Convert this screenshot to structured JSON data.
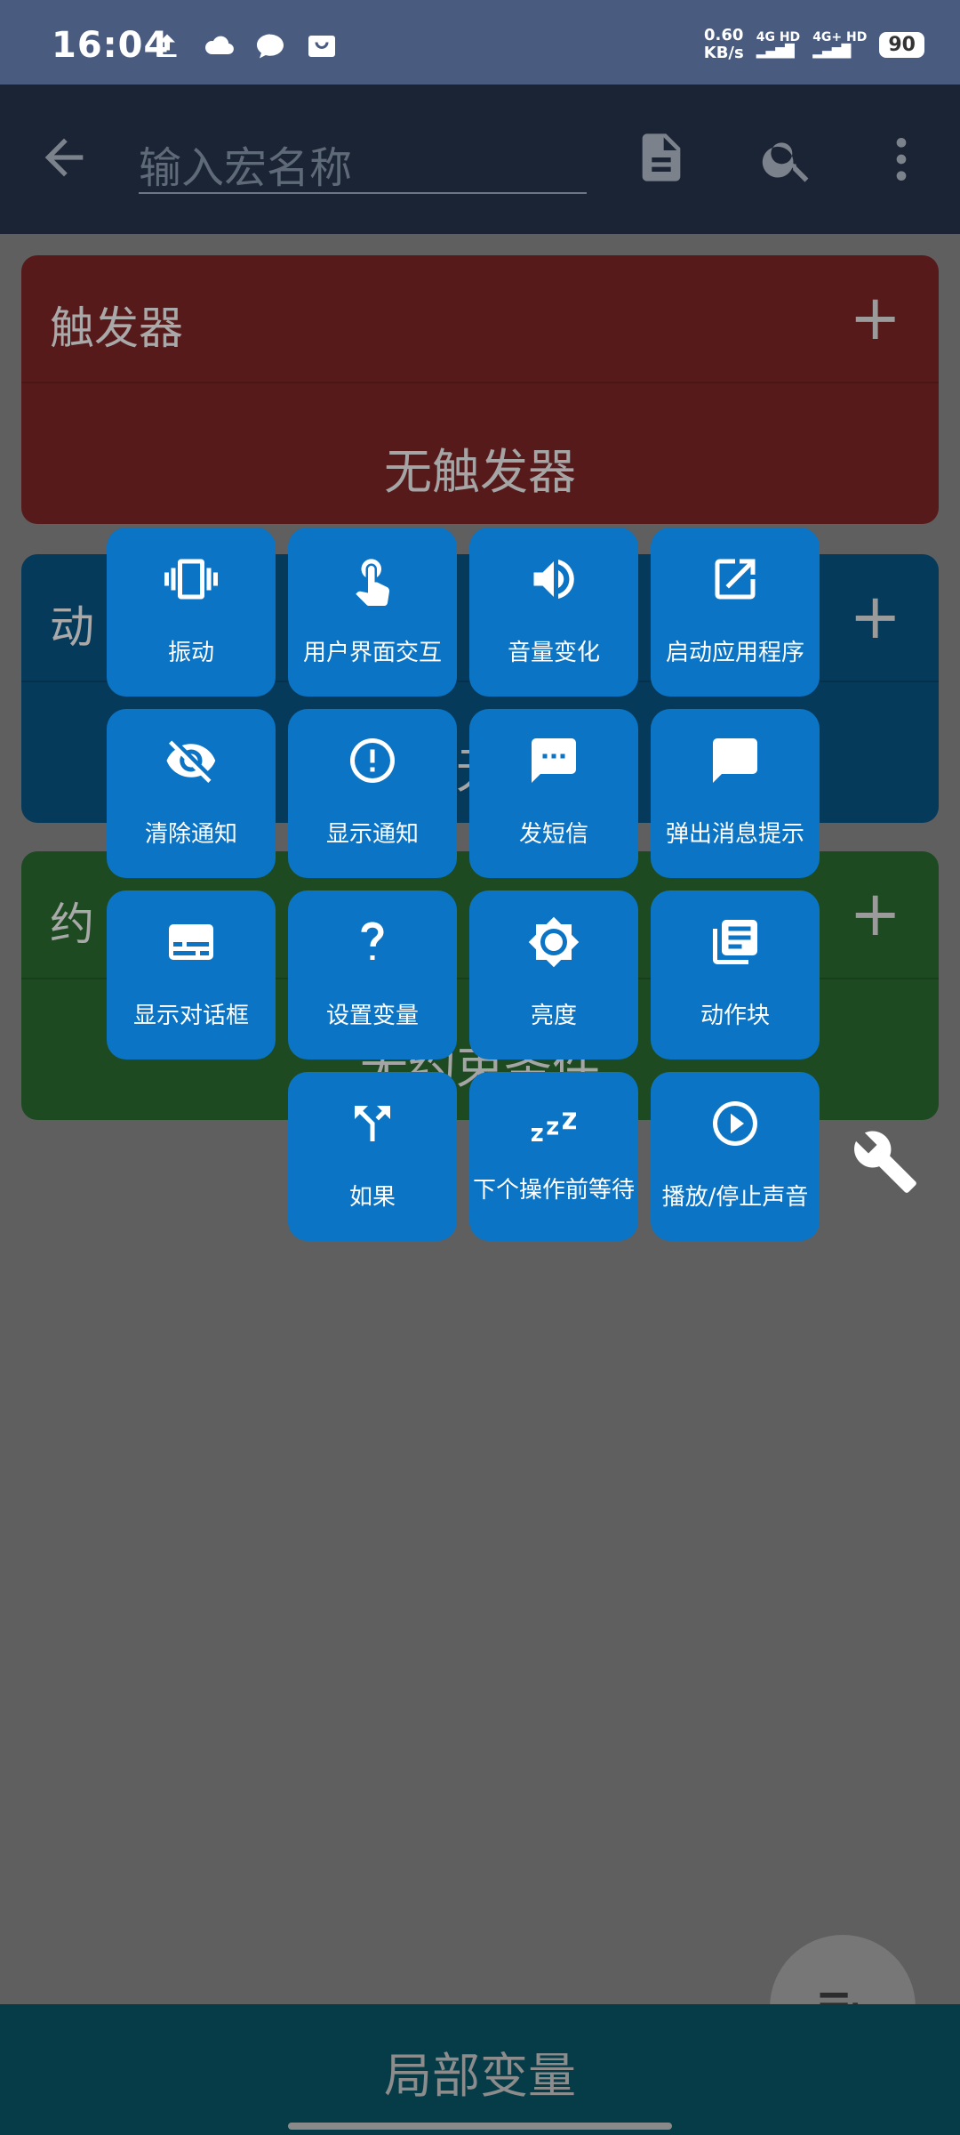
{
  "status_bar": {
    "time": "16:04",
    "speed_value": "0.60",
    "speed_unit": "KB/s",
    "net1": "4G HD",
    "net2": "4G+ HD",
    "battery": "90"
  },
  "app_bar": {
    "name_placeholder": "输入宏名称"
  },
  "cards": {
    "triggers": {
      "title": "触发器",
      "empty": "无触发器",
      "color": "#571a1b"
    },
    "actions": {
      "title_partial": "动",
      "empty_partial": "无",
      "color": "#063a5b"
    },
    "constraints": {
      "title_partial": "约",
      "empty_partial": "无约束条件",
      "color": "#1d4a20"
    }
  },
  "action_tiles": [
    {
      "label": "振动",
      "icon": "vibrate-icon"
    },
    {
      "label": "用户界面交互",
      "icon": "touch-icon"
    },
    {
      "label": "音量变化",
      "icon": "volume-icon"
    },
    {
      "label": "启动应用程序",
      "icon": "open-external-icon"
    },
    {
      "label": "清除通知",
      "icon": "eye-off-icon"
    },
    {
      "label": "显示通知",
      "icon": "alert-circle-icon"
    },
    {
      "label": "发短信",
      "icon": "sms-icon"
    },
    {
      "label": "弹出消息提示",
      "icon": "message-icon"
    },
    {
      "label": "显示对话框",
      "icon": "dialog-icon"
    },
    {
      "label": "设置变量",
      "icon": "question-icon"
    },
    {
      "label": "亮度",
      "icon": "brightness-icon"
    },
    {
      "label": "动作块",
      "icon": "library-icon"
    },
    {
      "label": "如果",
      "icon": "split-icon"
    },
    {
      "label": "下个操作前等待",
      "icon": "sleep-icon"
    },
    {
      "label": "播放/停止声音",
      "icon": "play-circle-icon"
    }
  ],
  "bottom_bar": {
    "label": "局部变量"
  },
  "colors": {
    "tile": "#0b74c4",
    "status_bar": "#4a5b80",
    "app_bar": "#1b2434"
  }
}
